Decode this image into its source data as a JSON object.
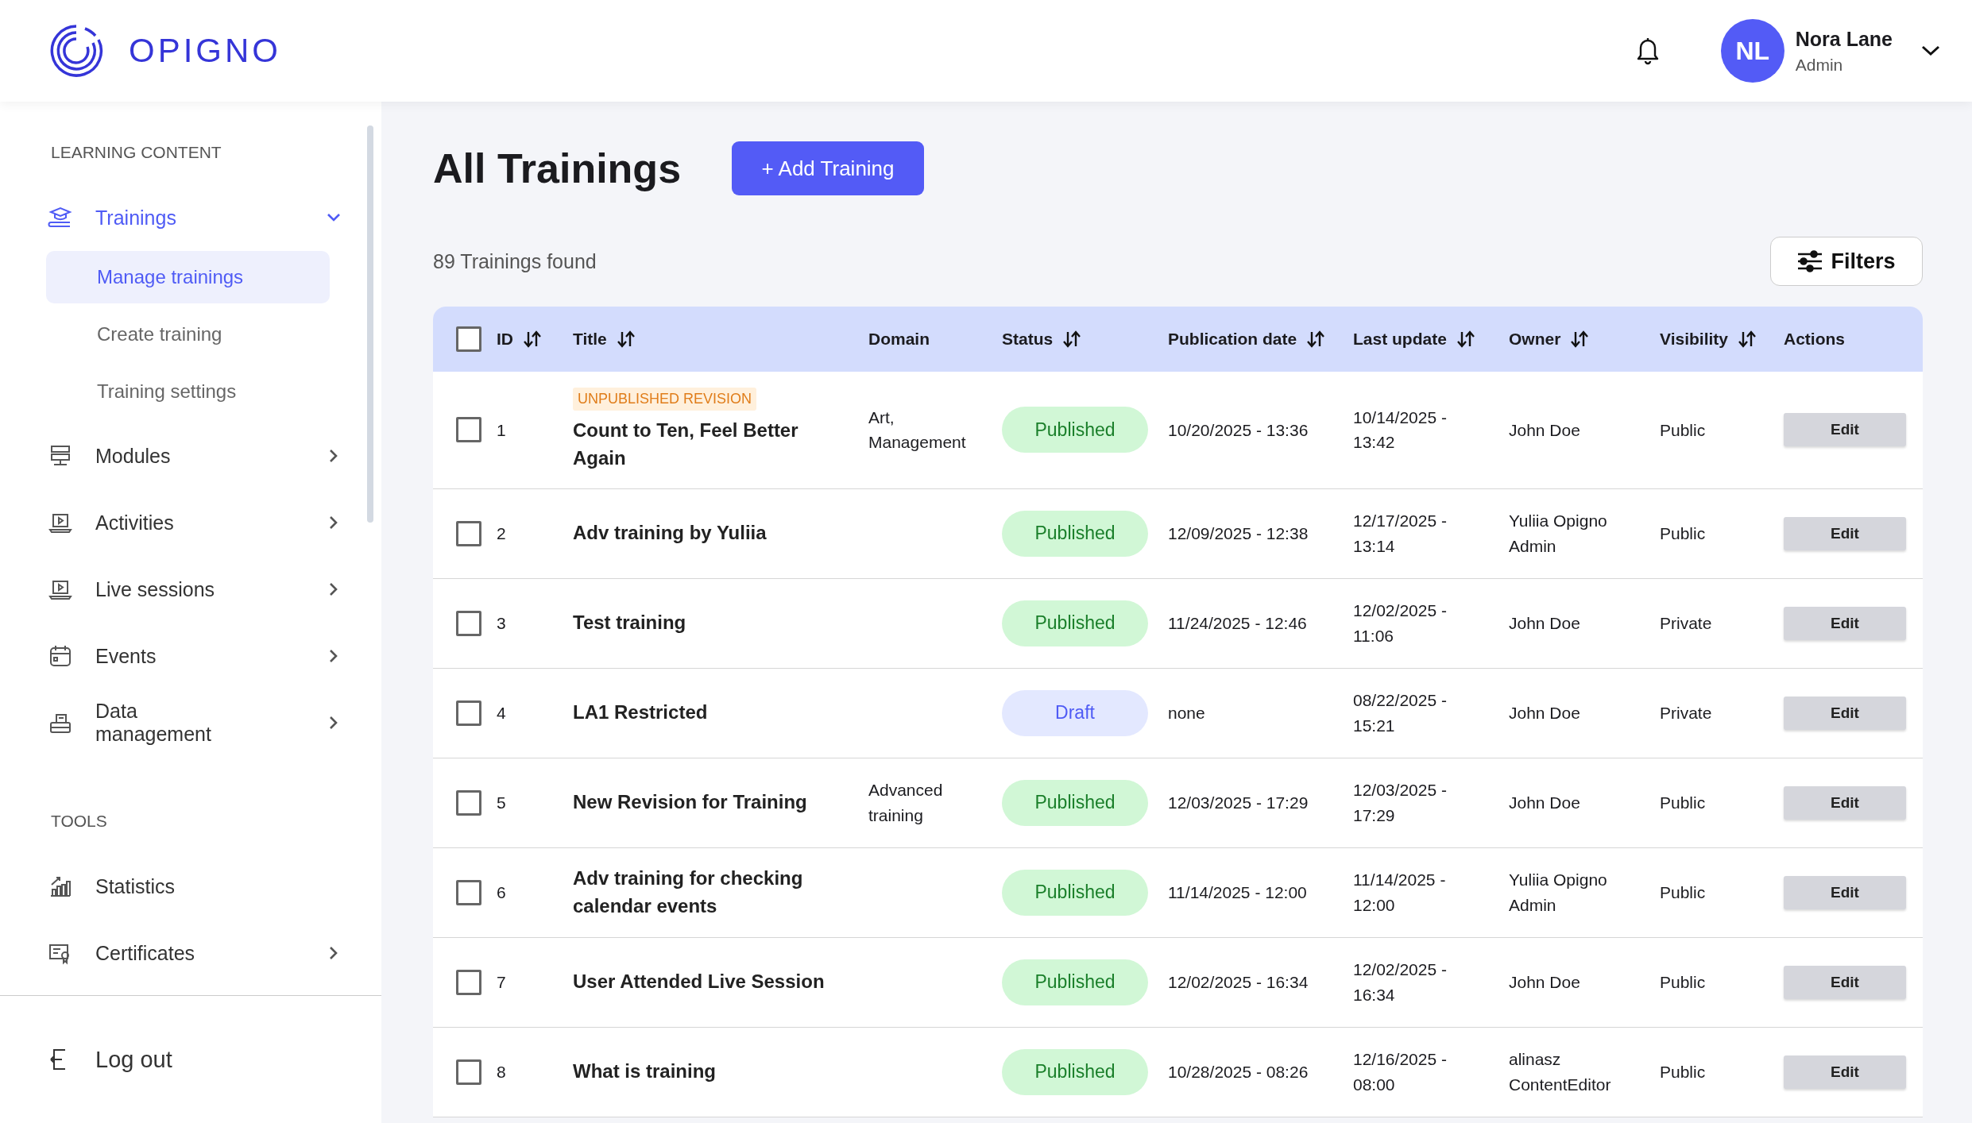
{
  "brand": {
    "name": "OPIGNO"
  },
  "header": {
    "user": {
      "initials": "NL",
      "name": "Nora Lane",
      "role": "Admin"
    }
  },
  "sidebar": {
    "sections": [
      {
        "heading": "LEARNING CONTENT",
        "items": [
          {
            "label": "Trainings",
            "kind": "group",
            "expanded": true,
            "selected": true,
            "children": [
              {
                "label": "Manage trainings",
                "selected": true
              },
              {
                "label": "Create training",
                "selected": false
              },
              {
                "label": "Training settings",
                "selected": false
              }
            ]
          },
          {
            "label": "Modules",
            "kind": "group",
            "expanded": false,
            "selected": false
          },
          {
            "label": "Activities",
            "kind": "group",
            "expanded": false,
            "selected": false
          },
          {
            "label": "Live sessions",
            "kind": "group",
            "expanded": false,
            "selected": false
          },
          {
            "label": "Events",
            "kind": "group",
            "expanded": false,
            "selected": false
          },
          {
            "label": "Data management",
            "kind": "group",
            "expanded": false,
            "selected": false
          }
        ]
      },
      {
        "heading": "TOOLS",
        "items": [
          {
            "label": "Statistics",
            "kind": "link",
            "selected": false
          },
          {
            "label": "Certificates",
            "kind": "group",
            "expanded": false,
            "selected": false
          }
        ]
      }
    ],
    "logout": "Log out"
  },
  "main": {
    "title": "All Trainings",
    "add_button": "+ Add Training",
    "count": "89 Trainings found",
    "filters_button": "Filters",
    "table": {
      "select_all": {
        "checked": false
      },
      "columns": [
        {
          "label": "ID",
          "sortable": true
        },
        {
          "label": "Title",
          "sortable": true
        },
        {
          "label": "Domain",
          "sortable": false
        },
        {
          "label": "Status",
          "sortable": true
        },
        {
          "label": "Publication date",
          "sortable": true
        },
        {
          "label": "Last update",
          "sortable": true
        },
        {
          "label": "Owner",
          "sortable": true
        },
        {
          "label": "Visibility",
          "sortable": true
        },
        {
          "label": "Actions",
          "sortable": false
        }
      ],
      "rows": [
        {
          "checked": false,
          "id": "1",
          "badge": "UNPUBLISHED REVISION",
          "title": "Count to Ten, Feel Better Again",
          "domain": "Art, Management",
          "status": {
            "label": "Published",
            "kind": "published"
          },
          "publication_date": "10/20/2025 - 13:36",
          "last_update": "10/14/2025 - 13:42",
          "owner": "John Doe",
          "visibility": "Public",
          "action": "Edit"
        },
        {
          "checked": false,
          "id": "2",
          "title": "Adv training by Yuliia",
          "status": {
            "label": "Published",
            "kind": "published"
          },
          "publication_date": "12/09/2025 - 12:38",
          "last_update": "12/17/2025 - 13:14",
          "owner": "Yuliia Opigno Admin",
          "visibility": "Public",
          "action": "Edit"
        },
        {
          "checked": false,
          "id": "3",
          "title": "Test training",
          "status": {
            "label": "Published",
            "kind": "published"
          },
          "publication_date": "11/24/2025 - 12:46",
          "last_update": "12/02/2025 - 11:06",
          "owner": "John Doe",
          "visibility": "Private",
          "action": "Edit"
        },
        {
          "checked": false,
          "id": "4",
          "title": "LA1 Restricted",
          "status": {
            "label": "Draft",
            "kind": "draft"
          },
          "publication_date": "none",
          "last_update": "08/22/2025 - 15:21",
          "owner": "John Doe",
          "visibility": "Private",
          "action": "Edit"
        },
        {
          "checked": false,
          "id": "5",
          "title": "New Revision for Training",
          "domain": "Advanced training",
          "status": {
            "label": "Published",
            "kind": "published"
          },
          "publication_date": "12/03/2025 - 17:29",
          "last_update": "12/03/2025 - 17:29",
          "owner": "John Doe",
          "visibility": "Public",
          "action": "Edit"
        },
        {
          "checked": false,
          "id": "6",
          "title": "Adv training for checking calendar events",
          "status": {
            "label": "Published",
            "kind": "published"
          },
          "publication_date": "11/14/2025 - 12:00",
          "last_update": "11/14/2025 - 12:00",
          "owner": "Yuliia Opigno Admin",
          "visibility": "Public",
          "action": "Edit"
        },
        {
          "checked": false,
          "id": "7",
          "title": "User Attended Live Session",
          "status": {
            "label": "Published",
            "kind": "published"
          },
          "publication_date": "12/02/2025 - 16:34",
          "last_update": "12/02/2025 - 16:34",
          "owner": "John Doe",
          "visibility": "Public",
          "action": "Edit"
        },
        {
          "checked": false,
          "id": "8",
          "title": "What is training",
          "status": {
            "label": "Published",
            "kind": "published"
          },
          "publication_date": "10/28/2025 - 08:26",
          "last_update": "12/16/2025 - 08:00",
          "owner": "alinasz ContentEditor",
          "visibility": "Public",
          "action": "Edit"
        }
      ]
    }
  }
}
